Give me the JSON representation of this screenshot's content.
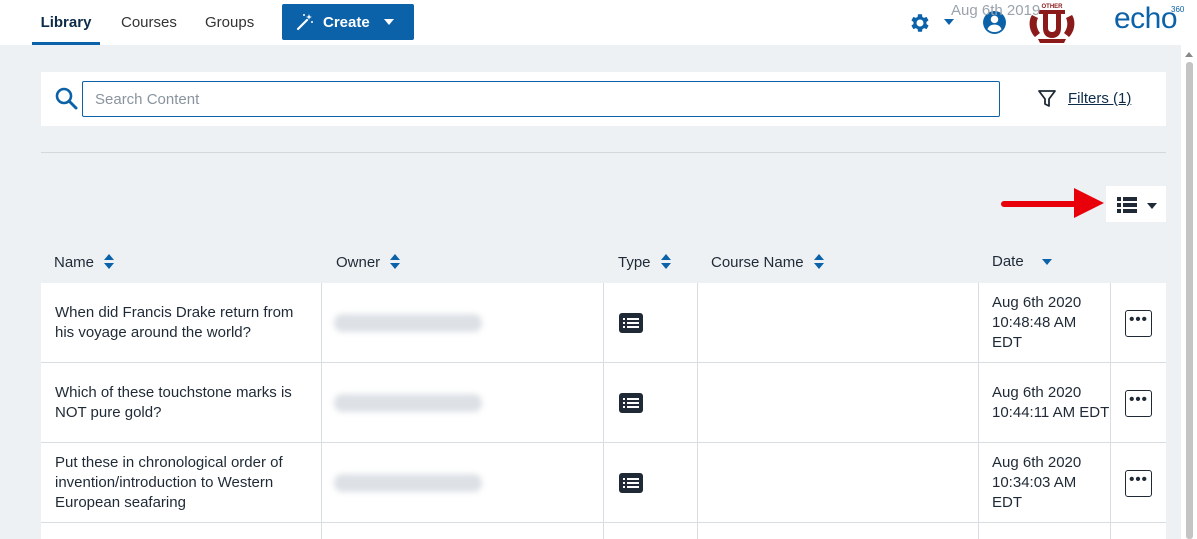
{
  "nav": {
    "tabs": [
      {
        "label": "Library",
        "active": true
      },
      {
        "label": "Courses",
        "active": false
      },
      {
        "label": "Groups",
        "active": false
      }
    ],
    "create_label": "Create"
  },
  "brand": {
    "name": "echo",
    "sup": "360",
    "logo_text_top": "OTHER",
    "logo_letter": "U"
  },
  "search": {
    "placeholder": "Search Content",
    "value": ""
  },
  "filters": {
    "label": "Filters (1)"
  },
  "table": {
    "headers": [
      "Name",
      "Owner",
      "Type",
      "Course Name",
      "Date"
    ],
    "rows": [
      {
        "name": "When did Francis Drake return from his voyage around the world?",
        "owner": "",
        "type_icon": "quiz-icon",
        "course": "",
        "date": "Aug 6th 2020 10:48:48 AM EDT"
      },
      {
        "name": "Which of these touchstone marks is NOT pure gold?",
        "owner": "",
        "type_icon": "quiz-icon",
        "course": "",
        "date": "Aug 6th 2020 10:44:11 AM EDT"
      },
      {
        "name": "Put these in chronological order of invention/introduction to Western European seafaring",
        "owner": "",
        "type_icon": "quiz-icon",
        "course": "",
        "date": "Aug 6th 2020 10:34:03 AM EDT"
      }
    ],
    "partial_row_date": "Aug 6th 2019",
    "menu_label": "•••"
  },
  "colors": {
    "accent": "#0b62a8",
    "annotation_arrow": "#e8000b",
    "logo": "#8b1a1a"
  }
}
